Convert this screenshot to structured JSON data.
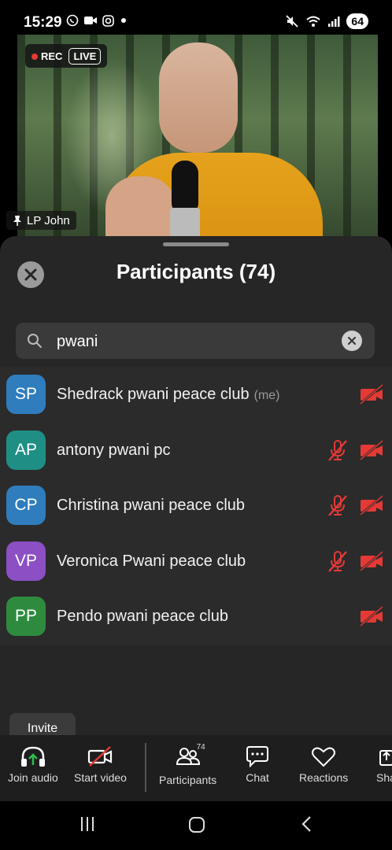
{
  "statusbar": {
    "time": "15:29",
    "left_icons": [
      "whatsapp-icon",
      "video-camera-icon",
      "instagram-icon",
      "dot-icon"
    ],
    "right_icons": [
      "mute-icon",
      "wifi-icon",
      "signal-icon"
    ],
    "battery": "64"
  },
  "video": {
    "rec_label": "REC",
    "live_label": "LIVE",
    "speaker_name": "LP John"
  },
  "panel": {
    "title": "Participants (74)",
    "search": {
      "value": "pwani",
      "placeholder": ""
    },
    "participants": [
      {
        "initials": "SP",
        "name": "Shedrack pwani peace club",
        "tag": "(me)",
        "color": "#2f7dbd",
        "mic_muted_shown": false,
        "video_off": true
      },
      {
        "initials": "AP",
        "name": "antony pwani pc",
        "tag": "",
        "color": "#1f8f86",
        "mic_muted_shown": true,
        "video_off": true
      },
      {
        "initials": "CP",
        "name": "Christina pwani peace club",
        "tag": "",
        "color": "#2f7dbd",
        "mic_muted_shown": true,
        "video_off": true
      },
      {
        "initials": "VP",
        "name": "Veronica Pwani peace club",
        "tag": "",
        "color": "#8c4fc4",
        "mic_muted_shown": true,
        "video_off": true
      },
      {
        "initials": "PP",
        "name": "Pendo pwani peace club",
        "tag": "",
        "color": "#2e8b3e",
        "mic_muted_shown": false,
        "video_off": true
      }
    ],
    "invite_label": "Invite"
  },
  "toolbar": {
    "join_audio": "Join audio",
    "start_video": "Start video",
    "participants": "Participants",
    "participants_count": "74",
    "chat": "Chat",
    "reactions": "Reactions",
    "share": "Sha"
  },
  "colors": {
    "muted_red": "#e53935",
    "sheet_bg": "#262626",
    "accent_green": "#2fbf4f"
  }
}
